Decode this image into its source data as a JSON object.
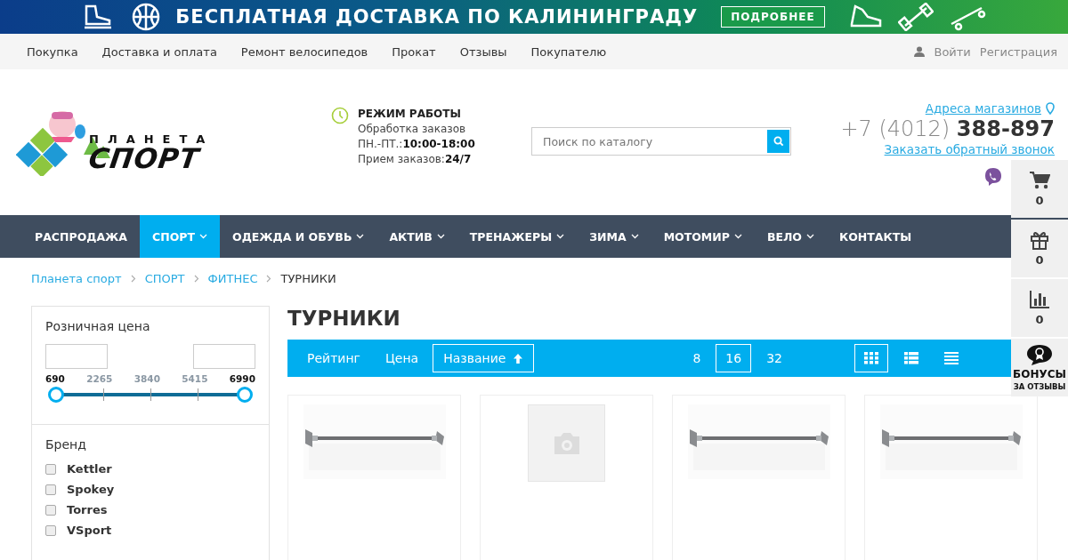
{
  "banner": {
    "text": "БЕСПЛАТНАЯ ДОСТАВКА ПО КАЛИНИНГРАДУ",
    "button": "ПОДРОБНЕЕ"
  },
  "top_nav": {
    "links": [
      "Покупка",
      "Доставка и оплата",
      "Ремонт велосипедов",
      "Прокат",
      "Отзывы",
      "Покупателю"
    ],
    "login": "Войти",
    "register": "Регистрация"
  },
  "logo": {
    "top": "ПЛАНЕТА",
    "bottom": "СПОРТ"
  },
  "hours": {
    "title": "РЕЖИМ РАБОТЫ",
    "lines": [
      {
        "label": "Обработка заказов"
      },
      {
        "label": "ПН.-ПТ.:",
        "value": "10:00-18:00"
      },
      {
        "label": "Прием заказов:",
        "value": "24/7"
      }
    ]
  },
  "search": {
    "placeholder": "Поиск по каталогу"
  },
  "contacts": {
    "stores_link": "Адреса магазинов",
    "phone_code": "+7 (4012)",
    "phone_number": "388-897",
    "callback_link": "Заказать обратный звонок"
  },
  "main_nav": [
    {
      "label": "РАСПРОДАЖА",
      "has_menu": false,
      "selected": false
    },
    {
      "label": "СПОРТ",
      "has_menu": true,
      "selected": true
    },
    {
      "label": "ОДЕЖДА И ОБУВЬ",
      "has_menu": true,
      "selected": false
    },
    {
      "label": "АКТИВ",
      "has_menu": true,
      "selected": false
    },
    {
      "label": "ТРЕНАЖЕРЫ",
      "has_menu": true,
      "selected": false
    },
    {
      "label": "ЗИМА",
      "has_menu": true,
      "selected": false
    },
    {
      "label": "МОТОМИР",
      "has_menu": true,
      "selected": false
    },
    {
      "label": "ВЕЛО",
      "has_menu": true,
      "selected": false
    },
    {
      "label": "КОНТАКТЫ",
      "has_menu": false,
      "selected": false
    }
  ],
  "side_panel": [
    {
      "kind": "cart",
      "count": "0"
    },
    {
      "kind": "gift",
      "count": "0"
    },
    {
      "kind": "compare",
      "count": "0"
    },
    {
      "kind": "bonus",
      "title": "БОНУСЫ",
      "subtitle": "ЗА ОТЗЫВЫ"
    }
  ],
  "breadcrumbs": [
    "Планета спорт",
    "СПОРТ",
    "ФИТНЕС",
    "ТУРНИКИ"
  ],
  "filters": {
    "price": {
      "title": "Розничная цена",
      "scale": [
        "690",
        "2265",
        "3840",
        "5415",
        "6990"
      ],
      "thumbs": [
        {
          "level": 0
        },
        {
          "level": 1
        }
      ]
    },
    "brand": {
      "title": "Бренд",
      "options": [
        {
          "label": "Kettler",
          "checked": false
        },
        {
          "label": "Spokey",
          "checked": false
        },
        {
          "label": "Torres",
          "checked": false
        },
        {
          "label": "VSport",
          "checked": false
        }
      ]
    }
  },
  "page_title": "ТУРНИКИ",
  "sort_options": [
    {
      "label": "Рейтинг",
      "selected": false
    },
    {
      "label": "Цена",
      "selected": false
    },
    {
      "label": "Название",
      "selected": true
    }
  ],
  "per_page": [
    {
      "label": "8",
      "selected": false
    },
    {
      "label": "16",
      "selected": true
    },
    {
      "label": "32",
      "selected": false
    }
  ],
  "views": [
    {
      "kind": "grid",
      "selected": true
    },
    {
      "kind": "list",
      "selected": false
    },
    {
      "kind": "table",
      "selected": false
    }
  ],
  "products": [
    {
      "kind": "picture"
    },
    {
      "kind": "placeholder"
    },
    {
      "kind": "picture"
    },
    {
      "kind": "picture"
    }
  ]
}
